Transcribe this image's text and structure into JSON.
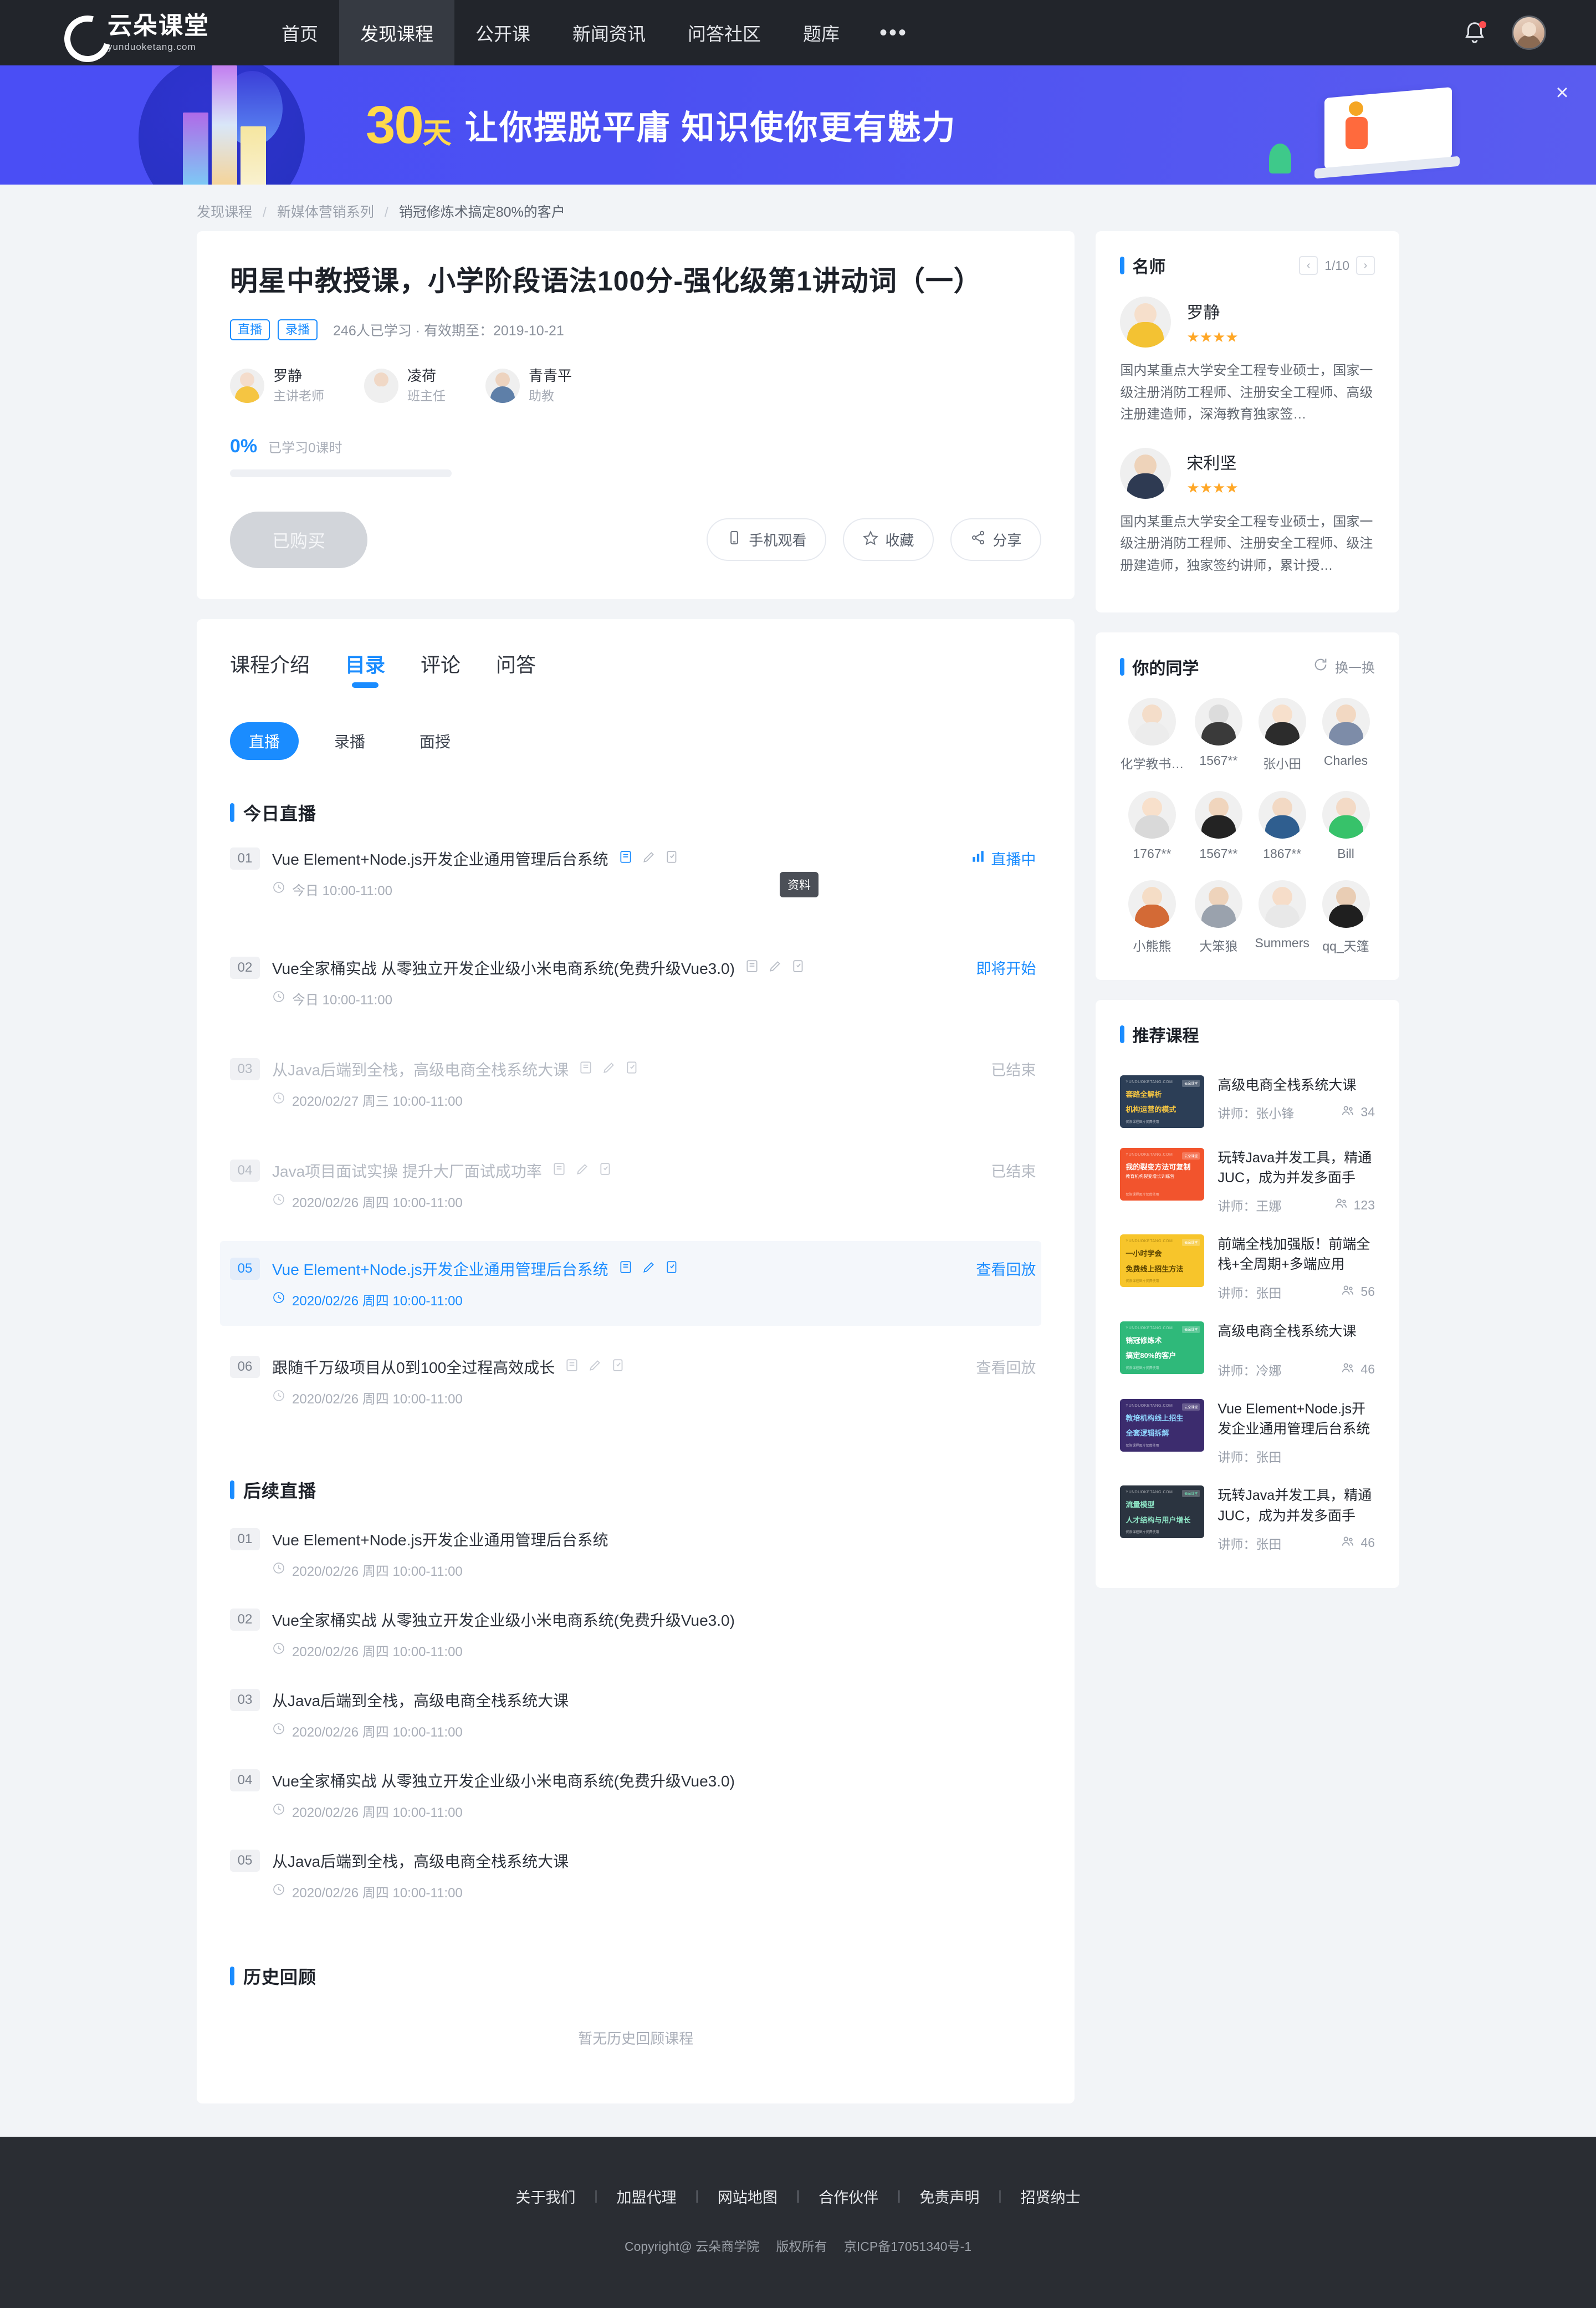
{
  "nav": {
    "logo_cn": "云朵课堂",
    "logo_en": "yunduoketang.com",
    "items": [
      {
        "label": "首页",
        "active": false
      },
      {
        "label": "发现课程",
        "active": true
      },
      {
        "label": "公开课",
        "active": false
      },
      {
        "label": "新闻资讯",
        "active": false
      },
      {
        "label": "问答社区",
        "active": false
      },
      {
        "label": "题库",
        "active": false
      }
    ],
    "more": "•••"
  },
  "banner": {
    "big_number": "30",
    "big_unit": "天",
    "text": "让你摆脱平庸  知识使你更有魅力",
    "close": "×"
  },
  "breadcrumb": {
    "item1": "发现课程",
    "item2": "新媒体营销系列",
    "item3": "销冠修炼术搞定80%的客户",
    "sep": "/"
  },
  "course": {
    "title": "明星中教授课，小学阶段语法100分-强化级第1讲动词（一）",
    "tag_live": "直播",
    "tag_record": "录播",
    "meta": "246人已学习 · 有效期至：2019-10-21",
    "teachers": [
      {
        "name": "罗静",
        "role": "主讲老师"
      },
      {
        "name": "凌荷",
        "role": "班主任"
      },
      {
        "name": "青青平",
        "role": "助教"
      }
    ],
    "progress_pct": "0%",
    "progress_text": "已学习0课时",
    "buy_button": "已购买",
    "pill_phone": "手机观看",
    "pill_fav": "收藏",
    "pill_share": "分享"
  },
  "tabs": [
    {
      "label": "课程介绍",
      "active": false
    },
    {
      "label": "目录",
      "active": true
    },
    {
      "label": "评论",
      "active": false
    },
    {
      "label": "问答",
      "active": false
    }
  ],
  "subtabs": [
    {
      "label": "直播",
      "active": true
    },
    {
      "label": "录播",
      "active": false
    },
    {
      "label": "面授",
      "active": false
    }
  ],
  "sections": {
    "today_title": "今日直播",
    "upcoming_title": "后续直播",
    "history_title": "历史回顾",
    "history_empty": "暂无历史回顾课程",
    "tooltip": "资料"
  },
  "today_lessons": [
    {
      "num": "01",
      "title": "Vue Element+Node.js开发企业通用管理后台系统",
      "time": "今日 10:00-11:00",
      "status": "直播中",
      "state": "live"
    },
    {
      "num": "02",
      "title": "Vue全家桶实战 从零独立开发企业级小米电商系统(免费升级Vue3.0)",
      "time": "今日 10:00-11:00",
      "status": "即将开始",
      "state": "soon"
    },
    {
      "num": "03",
      "title": "从Java后端到全栈，高级电商全栈系统大课",
      "time": "2020/02/27 周三 10:00-11:00",
      "status": "已结束",
      "state": "ended"
    },
    {
      "num": "04",
      "title": "Java项目面试实操 提升大厂面试成功率",
      "time": "2020/02/26 周四 10:00-11:00",
      "status": "已结束",
      "state": "ended"
    },
    {
      "num": "05",
      "title": "Vue Element+Node.js开发企业通用管理后台系统",
      "time": "2020/02/26 周四 10:00-11:00",
      "status": "查看回放",
      "state": "highlight"
    },
    {
      "num": "06",
      "title": "跟随千万级项目从0到100全过程高效成长",
      "time": "2020/02/26 周四 10:00-11:00",
      "status": "查看回放",
      "state": "replay-dim"
    }
  ],
  "upcoming_lessons": [
    {
      "num": "01",
      "title": "Vue Element+Node.js开发企业通用管理后台系统",
      "time": "2020/02/26 周四 10:00-11:00"
    },
    {
      "num": "02",
      "title": "Vue全家桶实战 从零独立开发企业级小米电商系统(免费升级Vue3.0)",
      "time": "2020/02/26 周四 10:00-11:00"
    },
    {
      "num": "03",
      "title": "从Java后端到全栈，高级电商全栈系统大课",
      "time": "2020/02/26 周四 10:00-11:00"
    },
    {
      "num": "04",
      "title": "Vue全家桶实战 从零独立开发企业级小米电商系统(免费升级Vue3.0)",
      "time": "2020/02/26 周四 10:00-11:00"
    },
    {
      "num": "05",
      "title": "从Java后端到全栈，高级电商全栈系统大课",
      "time": "2020/02/26 周四 10:00-11:00"
    }
  ],
  "sidebar": {
    "famous_title": "名师",
    "pager_text": "1/10",
    "pager_prev": "‹",
    "pager_next": "›",
    "famous_teachers": [
      {
        "name": "罗静",
        "stars": "★★★★",
        "desc": "国内某重点大学安全工程专业硕士，国家一级注册消防工程师、注册安全工程师、高级注册建造师，深海教育独家签…"
      },
      {
        "name": "宋利坚",
        "stars": "★★★★",
        "desc": "国内某重点大学安全工程专业硕士，国家一级注册消防工程师、注册安全工程师、级注册建造师，独家签约讲师，累计授…"
      }
    ],
    "mates_title": "你的同学",
    "refresh_label": "换一换",
    "mates": [
      {
        "name": "化学教书…"
      },
      {
        "name": "1567**"
      },
      {
        "name": "张小田"
      },
      {
        "name": "Charles"
      },
      {
        "name": "1767**"
      },
      {
        "name": "1567**"
      },
      {
        "name": "1867**"
      },
      {
        "name": "Bill"
      },
      {
        "name": "小熊熊"
      },
      {
        "name": "大笨狼"
      },
      {
        "name": "Summers"
      },
      {
        "name": "qq_天篷"
      }
    ],
    "rec_title": "推荐课程",
    "rec_teacher_prefix": "讲师：",
    "recommended": [
      {
        "title": "高级电商全栈系统大课",
        "teacher": "张小锋",
        "count": "34",
        "thumb_l1": "套路全解析",
        "thumb_l2": "机构运营的模式",
        "color": "#2c3e56"
      },
      {
        "title": "玩转Java并发工具，精通JUC，成为并发多面手",
        "teacher": "王娜",
        "count": "123",
        "thumb_l1": "我的裂变方法可复制",
        "thumb_l2": "教育机构裂变增长训练营",
        "color": "#f2542d"
      },
      {
        "title": "前端全栈加强版！前端全栈+全周期+多端应用",
        "teacher": "张田",
        "count": "56",
        "thumb_l1": "一小时学会",
        "thumb_l2": "免费线上招生方法",
        "color": "#f7c52b"
      },
      {
        "title": "高级电商全栈系统大课",
        "teacher": "冷娜",
        "count": "46",
        "thumb_l1": "销冠修炼术",
        "thumb_l2": "搞定80%的客户",
        "color": "#2fb97a"
      },
      {
        "title": "Vue Element+Node.js开发企业通用管理后台系统",
        "teacher": "张田",
        "count": "",
        "thumb_l1": "教培机构线上招生",
        "thumb_l2": "全套逻辑拆解",
        "color": "#3c2c6e"
      },
      {
        "title": "玩转Java并发工具，精通JUC，成为并发多面手",
        "teacher": "张田",
        "count": "46",
        "thumb_l1": "流量模型",
        "thumb_l2": "人才结构与用户增长",
        "color": "#2b3440"
      }
    ],
    "thumb_brand": "YUNDUOKETANG.COM",
    "thumb_badge": "云朵课堂",
    "thumb_foot": "仅限课程图片仅费使用"
  },
  "footer": {
    "links": [
      "关于我们",
      "加盟代理",
      "网站地图",
      "合作伙伴",
      "免责声明",
      "招贤纳士"
    ],
    "copyright": "Copyright@ 云朵商学院",
    "rights": "版权所有",
    "icp": "京ICP备17051340号-1"
  },
  "colors": {
    "accent": "#1a8cff",
    "nav_bg": "#22252b",
    "banner_blue": "#4a4ef5",
    "banner_yellow": "#ffd94a",
    "footer_bg": "#2a2d33"
  }
}
